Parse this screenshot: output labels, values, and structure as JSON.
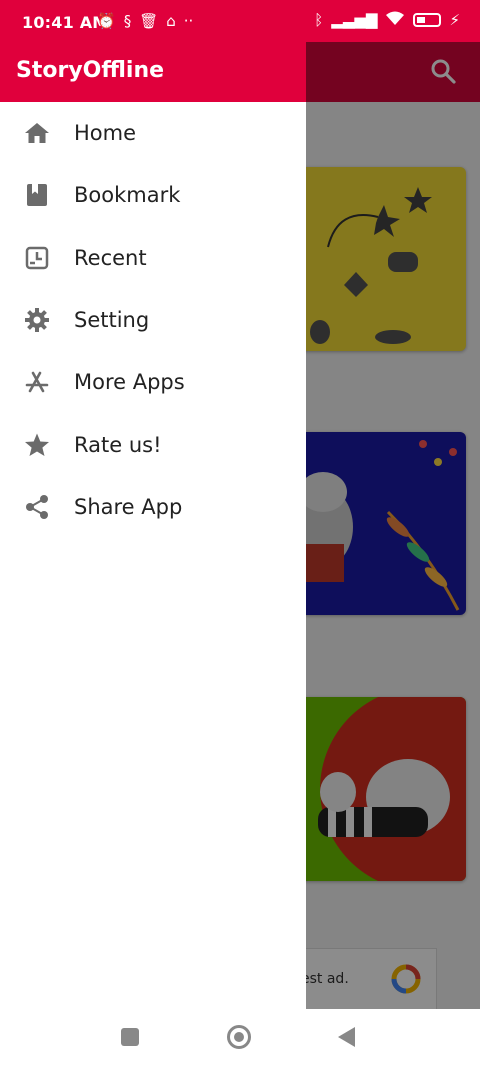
{
  "status_bar": {
    "time": "10:41 AM",
    "left_icons": [
      "alarm-icon",
      "notification-icon",
      "delete-icon",
      "home-icon",
      "more-dots-icon"
    ],
    "right_icons": [
      "bluetooth-icon",
      "signal-icon",
      "wifi-icon",
      "battery-icon",
      "charging-icon"
    ]
  },
  "drawer": {
    "title": "StoryOffline",
    "items": [
      {
        "label": "Home",
        "icon": "home-icon"
      },
      {
        "label": "Bookmark",
        "icon": "bookmark-icon"
      },
      {
        "label": "Recent",
        "icon": "recent-icon"
      },
      {
        "label": "Setting",
        "icon": "gear-icon"
      },
      {
        "label": "More Apps",
        "icon": "app-store-icon"
      },
      {
        "label": "Rate us!",
        "icon": "star-icon"
      },
      {
        "label": "Share App",
        "icon": "share-icon"
      }
    ]
  },
  "background": {
    "ad_text": "est ad."
  },
  "colors": {
    "brand": "#e0003c",
    "icon": "#6b6b6b",
    "text": "#222222"
  }
}
